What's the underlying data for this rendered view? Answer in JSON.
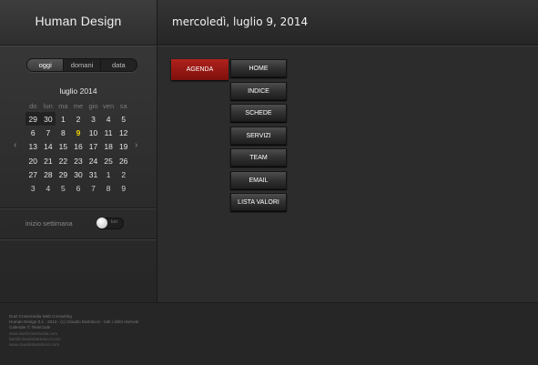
{
  "app": {
    "title": "Human Design"
  },
  "header": {
    "date": "mercoledì, luglio 9, 2014"
  },
  "segments": [
    {
      "label": "oggi",
      "active": true
    },
    {
      "label": "domani",
      "active": false
    },
    {
      "label": "data",
      "active": false
    }
  ],
  "calendar": {
    "month": "luglio 2014",
    "weekdays": [
      "do",
      "lun",
      "ma",
      "me",
      "gio",
      "ven",
      "sa"
    ],
    "weeks": [
      [
        "29",
        "30",
        "1",
        "2",
        "3",
        "4",
        "5"
      ],
      [
        "6",
        "7",
        "8",
        "9",
        "10",
        "11",
        "12"
      ],
      [
        "13",
        "14",
        "15",
        "16",
        "17",
        "18",
        "19"
      ],
      [
        "20",
        "21",
        "22",
        "23",
        "24",
        "25",
        "26"
      ],
      [
        "27",
        "28",
        "29",
        "30",
        "31",
        "1",
        "2"
      ],
      [
        "3",
        "4",
        "5",
        "6",
        "7",
        "8",
        "9"
      ]
    ],
    "today": "9",
    "prev_icon": "chevron-left-icon",
    "next_icon": "chevron-right-icon"
  },
  "settings": {
    "week_start_label": "inizio settimana",
    "toggle_text": "lun"
  },
  "nav": {
    "agenda": "AGENDA",
    "items": [
      "HOME",
      "INDICE",
      "SCHEDE",
      "SERVIZI",
      "TEAM",
      "EMAIL",
      "LISTA VALORI"
    ]
  },
  "footer": {
    "lines": [
      "Duel Crossmedia Web Consulting",
      "Human Design 0.1 - 2013 - (c) Claudio Bartolucci - tutti i diritti riservati",
      "Calendar © TeasCode",
      "www.duelcrossmedia.com",
      "bart@claudiobartolucci.com",
      "www.claudiobartolucci.com"
    ]
  },
  "colors": {
    "accent": "#a41a15",
    "today": "#f5d400"
  }
}
